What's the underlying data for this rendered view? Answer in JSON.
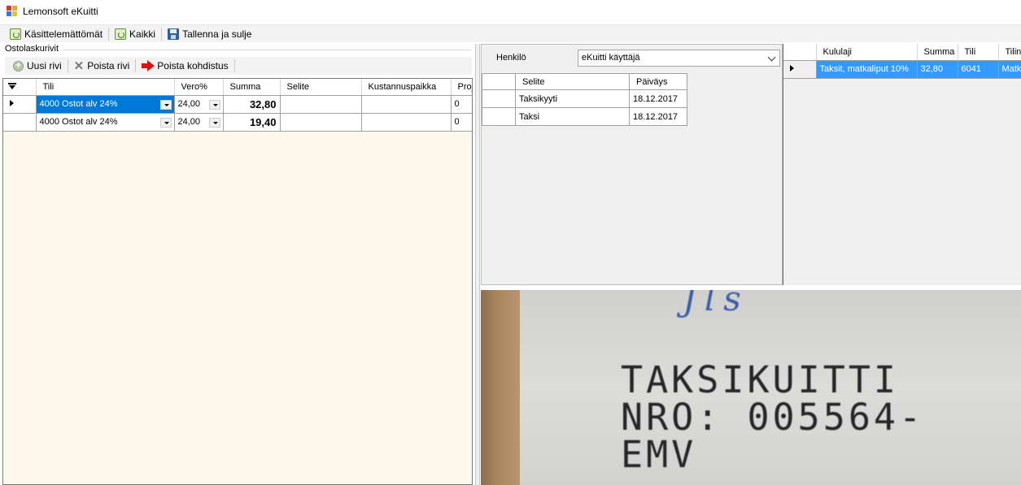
{
  "window": {
    "title": "Lemonsoft eKuitti"
  },
  "toolbar": {
    "unprocessed_label": "Käsittelemättömät",
    "all_label": "Kaikki",
    "save_close_label": "Tallenna ja sulje"
  },
  "left": {
    "group_title": "Ostolaskurivit",
    "buttons": {
      "new_row": "Uusi rivi",
      "delete_row": "Poista rivi",
      "delete_allocation": "Poista kohdistus"
    },
    "columns": [
      "Tili",
      "Vero%",
      "Summa",
      "Selite",
      "Kustannuspaikka",
      "Proj"
    ],
    "rows": [
      {
        "tili": "4000 Ostot alv 24%",
        "vero": "24,00",
        "summa": "32,80",
        "selite": "",
        "kustannuspaikka": "",
        "proj": "0"
      },
      {
        "tili": "4000 Ostot alv 24%",
        "vero": "24,00",
        "summa": "19,40",
        "selite": "",
        "kustannuspaikka": "",
        "proj": "0"
      }
    ]
  },
  "middle": {
    "person_label": "Henkilö",
    "person_value": "eKuitti käyttäjä",
    "columns": [
      "Selite",
      "Päiväys"
    ],
    "rows": [
      {
        "selite": "Taksikyyti",
        "paivays": "18.12.2017"
      },
      {
        "selite": "Taksi",
        "paivays": "18.12.2017"
      }
    ]
  },
  "right": {
    "columns": [
      "Kululaji",
      "Summa",
      "Tili",
      "Tilin"
    ],
    "rows": [
      {
        "kululaji": "Taksit, matkaliput 10%",
        "summa": "32,80",
        "tili": "6041",
        "tilin": "Matk"
      }
    ]
  },
  "preview": {
    "handwriting": "Jls",
    "lines": [
      "TAKSIKUITTI",
      "NRO: 005564-",
      "EMV"
    ]
  },
  "icons": {
    "app": "lemonsoft-app-icon",
    "refresh": "refresh-icon",
    "save": "save-disk-icon",
    "new": "add-icon",
    "delete": "delete-x-icon",
    "allocate": "red-arrow-icon"
  }
}
